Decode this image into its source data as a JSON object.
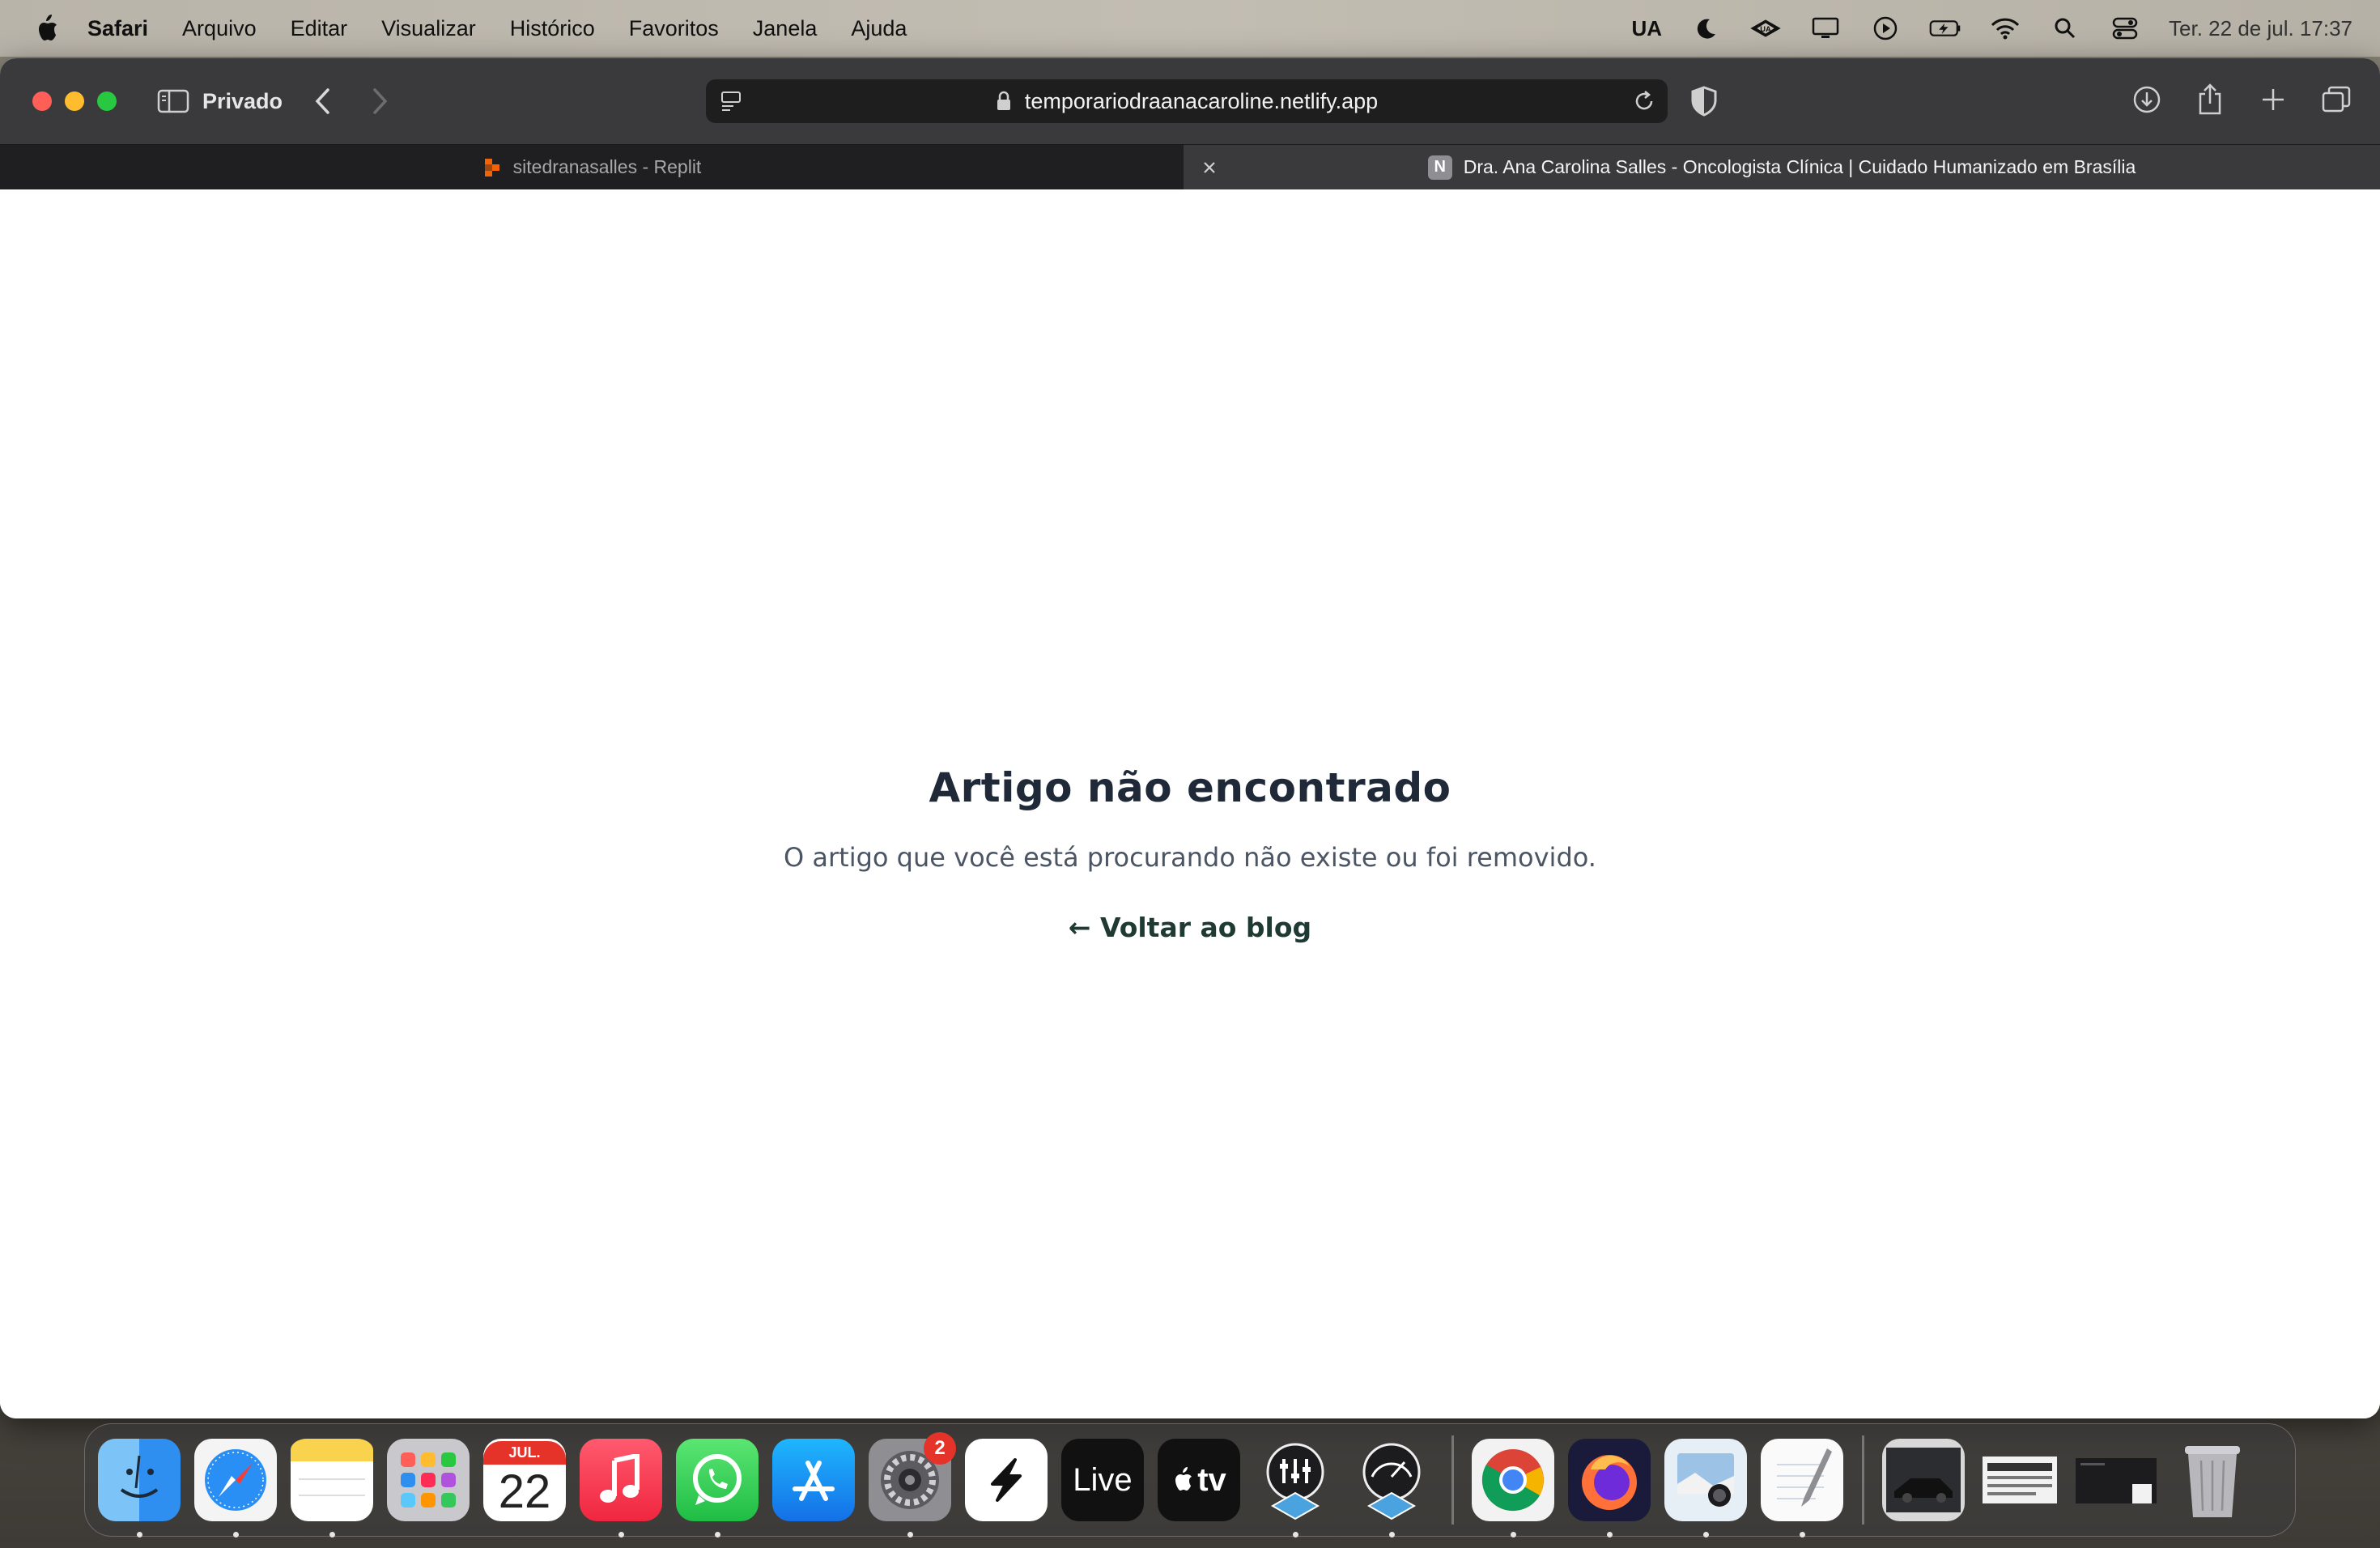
{
  "menubar": {
    "app_name": "Safari",
    "menus": [
      "Arquivo",
      "Editar",
      "Visualizar",
      "Histórico",
      "Favoritos",
      "Janela",
      "Ajuda"
    ],
    "status_text": "UA",
    "clock": "Ter. 22 de jul.  17:37"
  },
  "toolbar": {
    "private_label": "Privado",
    "url": "temporariodraanacaroline.netlify.app"
  },
  "tabs": [
    {
      "title": "sitedranasalles - Replit",
      "active": false
    },
    {
      "title": "Dra. Ana Carolina Salles - Oncologista Clínica | Cuidado Humanizado em Brasília",
      "active": true,
      "favicon_letter": "N"
    }
  ],
  "page": {
    "heading": "Artigo não encontrado",
    "message": "O artigo que você está procurando não existe ou foi removido.",
    "back_link": "← Voltar ao blog"
  },
  "dock": {
    "items": [
      {
        "name": "finder",
        "icon": "finder-icon"
      },
      {
        "name": "safari",
        "icon": "safari-icon"
      },
      {
        "name": "notes",
        "icon": "notes-icon"
      },
      {
        "name": "launchpad",
        "icon": "launchpad-icon"
      },
      {
        "name": "calendar",
        "icon": "calendar-icon",
        "month": "JUL.",
        "day": "22"
      },
      {
        "name": "music",
        "icon": "music-icon"
      },
      {
        "name": "whatsapp",
        "icon": "whatsapp-icon"
      },
      {
        "name": "app-store",
        "icon": "app-store-icon"
      },
      {
        "name": "system-settings",
        "icon": "gear-icon",
        "badge": "2"
      },
      {
        "name": "capcut",
        "icon": "capcut-icon"
      },
      {
        "name": "ableton-live",
        "icon": "live-icon",
        "label": "Live"
      },
      {
        "name": "apple-tv",
        "icon": "tv-icon",
        "label": "tv"
      },
      {
        "name": "ua-console",
        "icon": "ua-console-icon"
      },
      {
        "name": "ua-meter",
        "icon": "ua-meter-icon"
      },
      {
        "name": "chrome",
        "icon": "chrome-icon"
      },
      {
        "name": "firefox",
        "icon": "firefox-icon"
      },
      {
        "name": "preview",
        "icon": "preview-icon"
      },
      {
        "name": "textedit",
        "icon": "textedit-icon"
      },
      {
        "name": "recent-image-1",
        "icon": "thumbnail-icon"
      },
      {
        "name": "recent-image-2",
        "icon": "thumbnail-icon"
      },
      {
        "name": "recent-image-3",
        "icon": "thumbnail-icon"
      },
      {
        "name": "trash",
        "icon": "trash-icon"
      }
    ]
  }
}
